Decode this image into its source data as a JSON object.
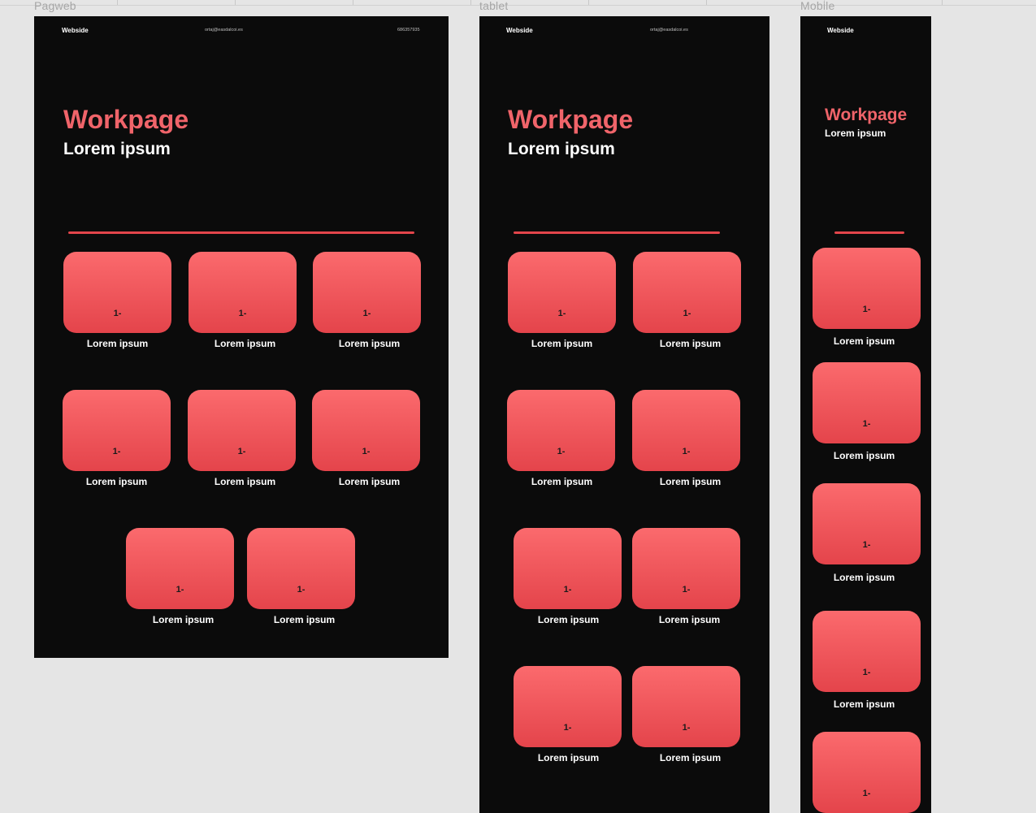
{
  "canvas": {
    "labels": {
      "web": "Pagweb",
      "tablet": "tablet",
      "mobile": "Mobile"
    }
  },
  "web": {
    "nav": {
      "brand": "Webside",
      "email": "ortaj@easdalcoi.es",
      "phone": "686357935"
    },
    "title": "Workpage",
    "subtitle": "Lorem ipsum",
    "cards": [
      {
        "number": "1-",
        "caption": "Lorem ipsum"
      },
      {
        "number": "1-",
        "caption": "Lorem ipsum"
      },
      {
        "number": "1-",
        "caption": "Lorem ipsum"
      },
      {
        "number": "1-",
        "caption": "Lorem ipsum"
      },
      {
        "number": "1-",
        "caption": "Lorem ipsum"
      },
      {
        "number": "1-",
        "caption": "Lorem ipsum"
      },
      {
        "number": "1-",
        "caption": "Lorem ipsum"
      },
      {
        "number": "1-",
        "caption": "Lorem ipsum"
      }
    ]
  },
  "tablet": {
    "nav": {
      "brand": "Webside",
      "email": "ortaj@easdalcoi.es"
    },
    "title": "Workpage",
    "subtitle": "Lorem ipsum",
    "cards": [
      {
        "number": "1-",
        "caption": "Lorem ipsum"
      },
      {
        "number": "1-",
        "caption": "Lorem ipsum"
      },
      {
        "number": "1-",
        "caption": "Lorem ipsum"
      },
      {
        "number": "1-",
        "caption": "Lorem ipsum"
      },
      {
        "number": "1-",
        "caption": "Lorem ipsum"
      },
      {
        "number": "1-",
        "caption": "Lorem ipsum"
      },
      {
        "number": "1-",
        "caption": "Lorem ipsum"
      },
      {
        "number": "1-",
        "caption": "Lorem ipsum"
      }
    ]
  },
  "mobile": {
    "nav": {
      "brand": "Webside"
    },
    "title": "Workpage",
    "subtitle": "Lorem ipsum",
    "cards": [
      {
        "number": "1-",
        "caption": "Lorem ipsum"
      },
      {
        "number": "1-",
        "caption": "Lorem ipsum"
      },
      {
        "number": "1-",
        "caption": "Lorem ipsum"
      },
      {
        "number": "1-",
        "caption": "Lorem ipsum"
      },
      {
        "number": "1-"
      }
    ]
  },
  "colors": {
    "frame_background": "#0b0b0b",
    "accent": "#f0646a",
    "card_gradient_top": "#fb6a6d",
    "card_gradient_bottom": "#e4444b",
    "canvas_background": "#e5e5e5"
  }
}
